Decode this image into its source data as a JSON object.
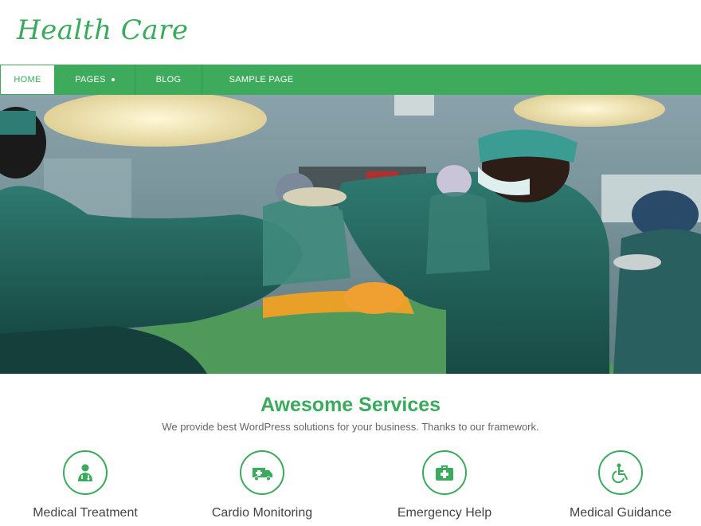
{
  "site": {
    "logo": "Health Care"
  },
  "nav": {
    "items": [
      {
        "label": "HOME",
        "active": true
      },
      {
        "label": "PAGES",
        "has_dropdown": true
      },
      {
        "label": "BLOG"
      },
      {
        "label": "SAMPLE PAGE"
      }
    ]
  },
  "services": {
    "title": "Awesome Services",
    "subtitle": "We provide best WordPress solutions for your business. Thanks to our framework.",
    "items": [
      {
        "label": "Medical Treatment",
        "icon": "doctor-icon"
      },
      {
        "label": "Cardio Monitoring",
        "icon": "ambulance-icon"
      },
      {
        "label": "Emergency Help",
        "icon": "first-aid-kit-icon"
      },
      {
        "label": "Medical Guidance",
        "icon": "wheelchair-icon"
      }
    ]
  },
  "colors": {
    "brand_green": "#3daa5c",
    "header_bg": "#ffffff"
  }
}
